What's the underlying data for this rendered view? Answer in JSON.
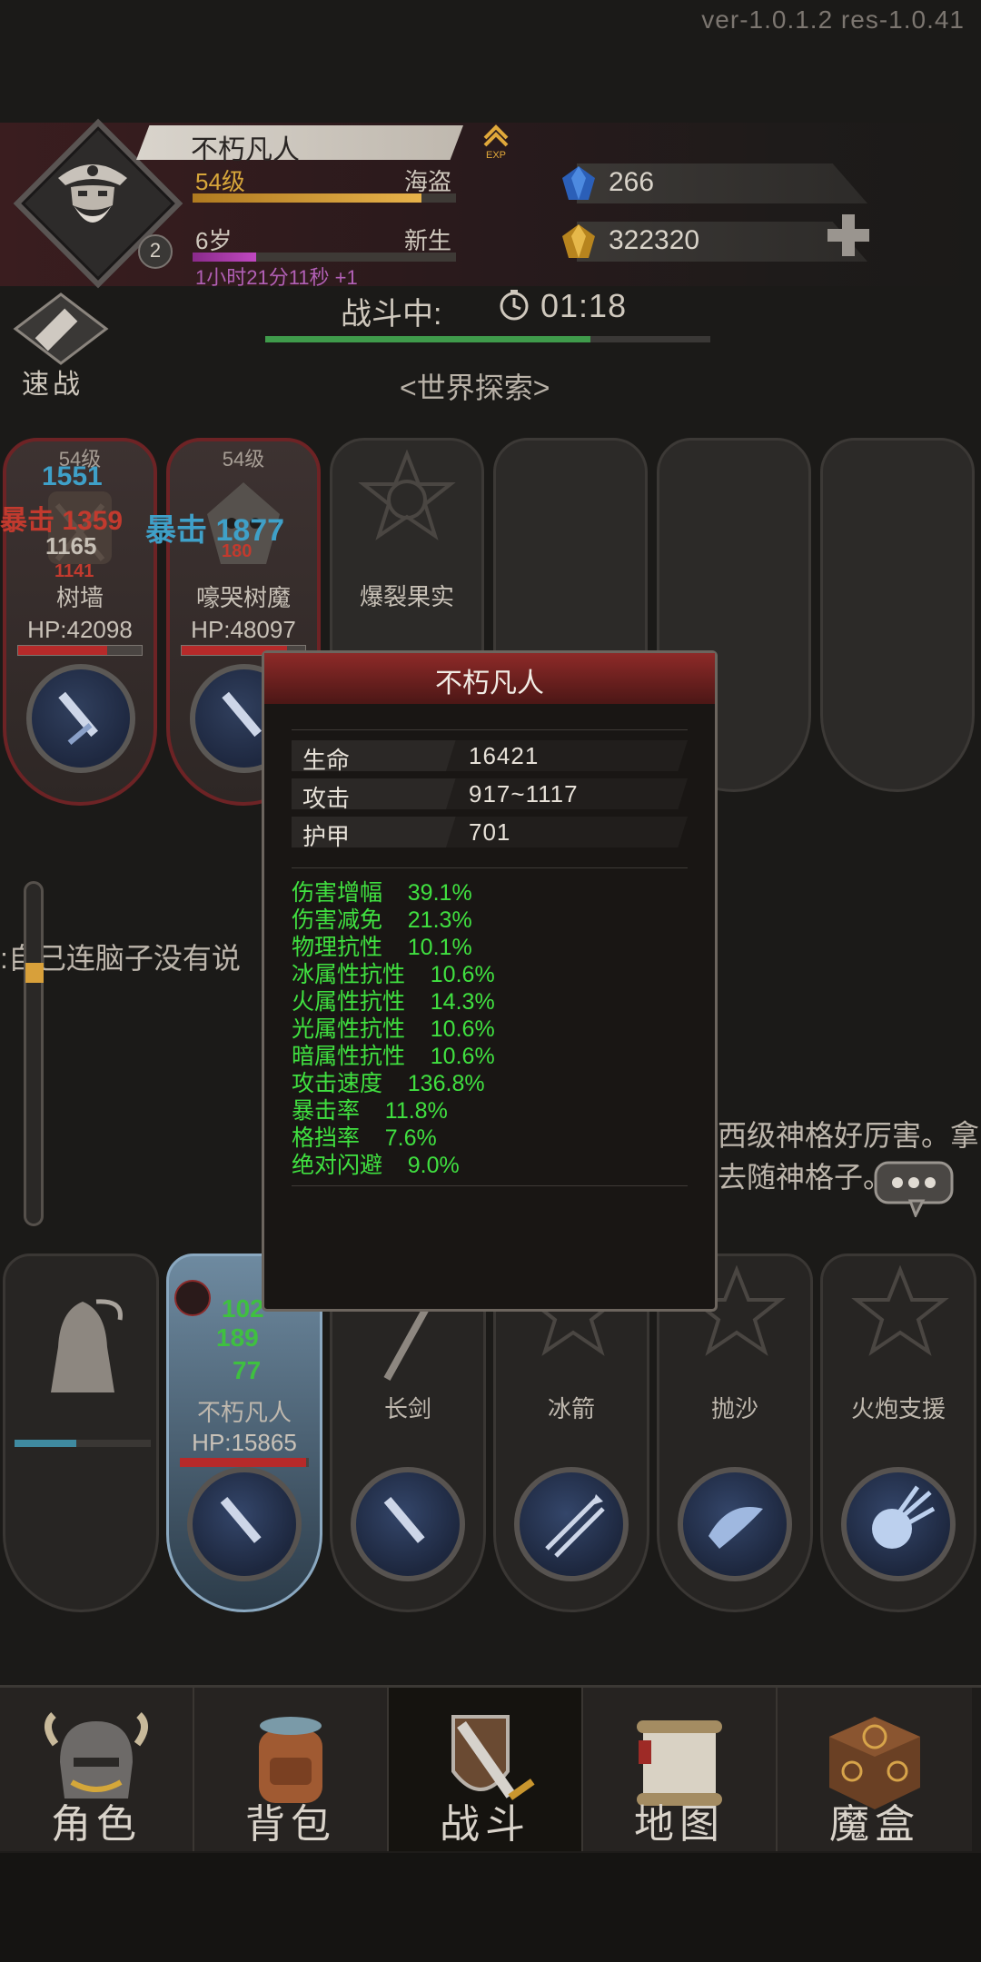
{
  "version": "ver-1.0.1.2  res-1.0.41",
  "player": {
    "name": "不朽凡人",
    "exp_label": "EXP",
    "level": "54级",
    "job": "海盗",
    "level_progress": 0.87,
    "age": "6岁",
    "age_stage": "新生",
    "age_progress": 0.24,
    "timer": "1小时21分11秒 +1",
    "avatar_badge": "2"
  },
  "resources": {
    "gems": "266",
    "gold": "322320"
  },
  "battle": {
    "speed_label": "速战",
    "status_label": "战斗中:",
    "time": "01:18",
    "progress": 0.73,
    "location": "<世界探索>"
  },
  "enemies": [
    {
      "level": "54级",
      "name": "树墙",
      "hp": "HP:42098",
      "hp_ratio": 0.72
    },
    {
      "level": "54级",
      "name": "嚎哭树魔",
      "hp": "HP:48097",
      "hp_ratio": 0.85
    },
    {
      "name": "爆裂果实"
    }
  ],
  "damage_texts": {
    "d1": "1551",
    "d2": "暴击 1359",
    "d3": "1165",
    "d4": "1141",
    "d5": "暴击 1877",
    "d6": "180"
  },
  "tooltip": {
    "title": "不朽凡人",
    "stats": [
      {
        "name": "生命",
        "value": "16421"
      },
      {
        "name": "攻击",
        "value": "917~1117"
      },
      {
        "name": "护甲",
        "value": "701"
      }
    ],
    "extra": [
      "伤害增幅    39.1%",
      "伤害减免    21.3%",
      "物理抗性    10.1%",
      "冰属性抗性    10.6%",
      "火属性抗性    14.3%",
      "光属性抗性    10.6%",
      "暗属性抗性    10.6%",
      "攻击速度    136.8%",
      "暴击率    11.8%",
      "格挡率    7.6%",
      "绝对闪避    9.0%"
    ]
  },
  "chat": {
    "line1": ":自己连脑子没有说",
    "line2": "西级神格好厉害。拿去随神格子。。"
  },
  "party": [
    {
      "name": ""
    },
    {
      "name": "不朽凡人",
      "hp": "HP:15865",
      "hp_ratio": 0.98,
      "heal1": "102",
      "heal2": "189",
      "heal3": "77"
    },
    {
      "name": "长剑"
    },
    {
      "name": "冰箭"
    },
    {
      "name": "抛沙"
    },
    {
      "name": "火炮支援"
    }
  ],
  "nav": [
    {
      "label": "角色"
    },
    {
      "label": "背包"
    },
    {
      "label": "战斗"
    },
    {
      "label": "地图"
    },
    {
      "label": "魔盒"
    }
  ]
}
